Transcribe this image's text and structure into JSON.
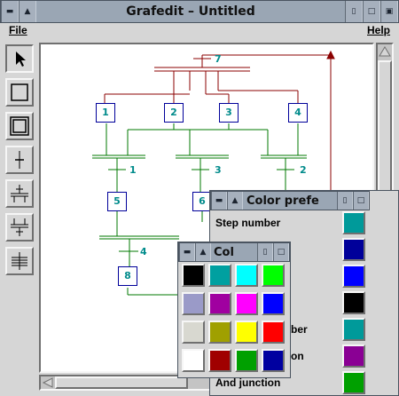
{
  "window": {
    "title": "Grafedit – Untitled",
    "menu": {
      "file": "File",
      "help": "Help"
    }
  },
  "toolbar": {
    "tools": [
      "select",
      "step",
      "initial-step",
      "transition",
      "and-divergence",
      "and-convergence",
      "or-junction"
    ]
  },
  "diagram": {
    "initial_step_number": "7",
    "steps": [
      "1",
      "2",
      "3",
      "4",
      "5",
      "6",
      "8"
    ],
    "transitions": [
      "1",
      "3",
      "2",
      "4"
    ],
    "link_color": "#8b0000",
    "flow_color": "#007a00",
    "label_color": "#008b8b",
    "box_border": "#00009a"
  },
  "color_prefs": {
    "title": "Color prefe",
    "labels": {
      "step_number": "Step number",
      "item_b": "ber",
      "item_c": "on",
      "and_junction": "And junction"
    },
    "colors": [
      "#009a9a",
      "#00009a",
      "#0000ff",
      "#000000",
      "#009a9a",
      "#8a0094",
      "#00a000"
    ]
  },
  "color_picker": {
    "title": "Col",
    "colors": [
      "#000000",
      "#00a0a0",
      "#00ffff",
      "#00ff00",
      "#9a9ac8",
      "#a000a0",
      "#ff00ff",
      "#0000ff",
      "#d8d8d0",
      "#a0a000",
      "#ffff00",
      "#ff0000",
      "#ffffff",
      "#a00000",
      "#00a000",
      "#0000a0"
    ]
  }
}
